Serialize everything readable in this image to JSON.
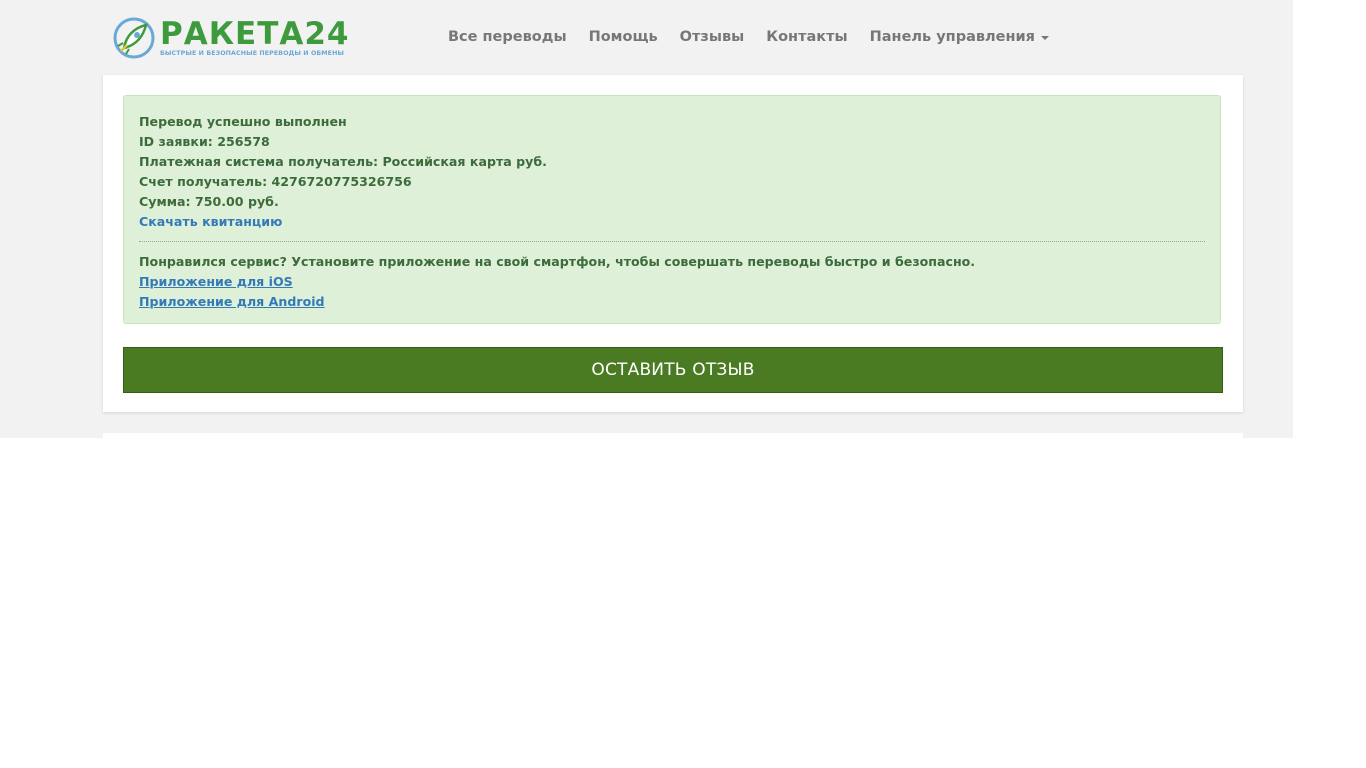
{
  "header": {
    "logo": {
      "title": "РАКЕТА24",
      "subtitle": "БЫСТРЫЕ И БЕЗОПАСНЫЕ ПЕРЕВОДЫ И ОБМЕНЫ",
      "icon": "rocket-icon"
    },
    "nav": {
      "items": [
        {
          "label": "Все переводы"
        },
        {
          "label": "Помощь"
        },
        {
          "label": "Отзывы"
        },
        {
          "label": "Контакты"
        },
        {
          "label": "Панель управления"
        }
      ]
    }
  },
  "result": {
    "status": "Перевод успешно выполнен",
    "order_id": "ID заявки: 256578",
    "payment_system": "Платежная система получатель: Российская карта руб.",
    "account": "Счет получатель: 4276720775326756",
    "amount": "Сумма: 750.00 руб.",
    "receipt_link": "Скачать квитанцию",
    "promo": "Понравился сервис? Установите приложение на свой смартфон, чтобы совершать переводы быстро и безопасно.",
    "ios_link": "Приложение для iOS",
    "android_link": "Приложение для Android"
  },
  "review_button": {
    "label": "ОСТАВИТЬ ОТЗЫВ"
  },
  "colors": {
    "accent_green": "#4a7a22",
    "alert_bg": "#dff0d8",
    "link": "#337ab7",
    "brand_green": "#3d9a3d"
  }
}
